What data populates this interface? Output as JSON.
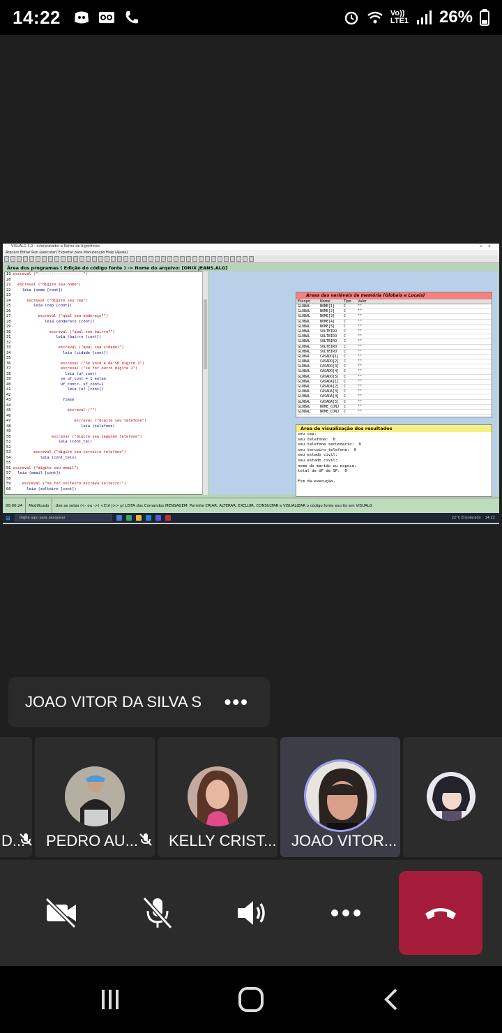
{
  "status_bar": {
    "time": "14:22",
    "network_label": "LTE1",
    "network_top": "Vo))",
    "battery": "26%"
  },
  "shared_screen": {
    "window_title": "VISUALG 3.0 - Interpretador e Editor de Algoritmos",
    "menu": "Arquivo   Editar   Run (executar)   Exportar para   Manutenção   Help (Ajuda)",
    "programs_header": "Área dos programas ( Edição do código fonte ) -> Nome do arquivo: [ONIX JEANS.ALG]",
    "code_lines": [
      {
        "n": "19",
        "t": "escreval (\"--------------------\")"
      },
      {
        "n": "20",
        "t": ""
      },
      {
        "n": "21",
        "t": "  escreval (\"digite seu nome\")"
      },
      {
        "n": "22",
        "t": "    leia (nome [cont])"
      },
      {
        "n": "23",
        "t": ""
      },
      {
        "n": "24",
        "t": "      escreval (\"digite seu cep\")"
      },
      {
        "n": "25",
        "t": "         leia (cep [cont])"
      },
      {
        "n": "26",
        "t": ""
      },
      {
        "n": "27",
        "t": "           escreval (\"qual seu endereço?\")"
      },
      {
        "n": "28",
        "t": "              leia (endereco [cont])"
      },
      {
        "n": "29",
        "t": ""
      },
      {
        "n": "30",
        "t": "                escreval (\"qual seu bairro?\")"
      },
      {
        "n": "31",
        "t": "                   leia (bairro [cont])"
      },
      {
        "n": "32",
        "t": ""
      },
      {
        "n": "33",
        "t": "                    escreval (\"qual sua cidade?\")"
      },
      {
        "n": "34",
        "t": "                      leia (cidade [cont])"
      },
      {
        "n": "35",
        "t": ""
      },
      {
        "n": "36",
        "t": "                     escreval (\"Se você é de SP digite 1\")"
      },
      {
        "n": "37",
        "t": "                     escreval (\"se for outro digite 2\")"
      },
      {
        "n": "38",
        "t": "                       leia (uf_cont)"
      },
      {
        "n": "39",
        "t": "                     se uf_cont = 1 entao"
      },
      {
        "n": "40",
        "t": "                     uf_cont<- uf_cont+1"
      },
      {
        "n": "41",
        "t": "                        leia (uf [cont])"
      },
      {
        "n": "42",
        "t": ""
      },
      {
        "n": "43",
        "t": "                      fimse"
      },
      {
        "n": "44",
        "t": ""
      },
      {
        "n": "45",
        "t": "                        escreval (\"\")"
      },
      {
        "n": "46",
        "t": ""
      },
      {
        "n": "47",
        "t": "                           escreval (\"digite seu telefone\")"
      },
      {
        "n": "48",
        "t": "                              leia (telefone)"
      },
      {
        "n": "49",
        "t": ""
      },
      {
        "n": "50",
        "t": "                 escreval (\"digite seu segundo telefone\")"
      },
      {
        "n": "51",
        "t": "                    leia (cont_tel)"
      },
      {
        "n": "52",
        "t": ""
      },
      {
        "n": "53",
        "t": "         escreval (\"digite seu terceiro telefone\")"
      },
      {
        "n": "54",
        "t": "            leia (cont_tels)"
      },
      {
        "n": "55",
        "t": ""
      },
      {
        "n": "56",
        "t": "escreval (\"digite seu email\")"
      },
      {
        "n": "57",
        "t": "  leia (email [cont])"
      },
      {
        "n": "58",
        "t": ""
      },
      {
        "n": "59",
        "t": "    escreval (\"se for solteiro escreva solteiro:\")"
      },
      {
        "n": "60",
        "t": "      leia (solteiro [cont])"
      }
    ],
    "vars_title": "Áreas das variáveis de memória (Globais e Locais)",
    "vars_headers": [
      "Escopo",
      "Nome",
      "Tipo",
      "Valor"
    ],
    "vars_rows": [
      [
        "GLOBAL",
        "NOME[1]",
        "C",
        "\"\""
      ],
      [
        "GLOBAL",
        "NOME[2]",
        "C",
        "\"\""
      ],
      [
        "GLOBAL",
        "NOME[3]",
        "C",
        "\"\""
      ],
      [
        "GLOBAL",
        "NOME[4]",
        "C",
        "\"\""
      ],
      [
        "GLOBAL",
        "NOME[5]",
        "C",
        "\"\""
      ],
      [
        "GLOBAL",
        "SOLTEIRO",
        "C",
        "\"\""
      ],
      [
        "GLOBAL",
        "SOLTEIRO",
        "C",
        "\"\""
      ],
      [
        "GLOBAL",
        "SOLTEIRO",
        "C",
        "\"\""
      ],
      [
        "GLOBAL",
        "SOLTEIRO",
        "C",
        "\"\""
      ],
      [
        "GLOBAL",
        "SOLTEIRO",
        "C",
        "\"\""
      ],
      [
        "GLOBAL",
        "CASADO[1]",
        "C",
        "\"\""
      ],
      [
        "GLOBAL",
        "CASADO[2]",
        "C",
        "\"\""
      ],
      [
        "GLOBAL",
        "CASADO[3]",
        "C",
        "\"\""
      ],
      [
        "GLOBAL",
        "CASADO[4]",
        "C",
        "\"\""
      ],
      [
        "GLOBAL",
        "CASADO[5]",
        "C",
        "\"\""
      ],
      [
        "GLOBAL",
        "CASADA[1]",
        "C",
        "\"\""
      ],
      [
        "GLOBAL",
        "CASADA[2]",
        "C",
        "\"\""
      ],
      [
        "GLOBAL",
        "CASADA[3]",
        "C",
        "\"\""
      ],
      [
        "GLOBAL",
        "CASADA[4]",
        "C",
        "\"\""
      ],
      [
        "GLOBAL",
        "CASADA[5]",
        "C",
        "\"\""
      ],
      [
        "GLOBAL",
        "NOME_CONJ",
        "C",
        "\"\""
      ],
      [
        "GLOBAL",
        "NOME_CONJ",
        "C",
        "\"\""
      ]
    ],
    "results_title": "Área de visualização dos resultados",
    "results_lines": [
      "seu cep:",
      "seu telefone:  0",
      "seu telefone secundario:  0",
      "seu terceiro telefone:  0",
      "seu estado civil:",
      "seu estado civil:",
      "nome do marido ou esposa:",
      "total de UF de SP:  0",
      "",
      "Fim da execução."
    ],
    "status_cells": [
      "00:00:24",
      "Modificado",
      "Use as setas (<- ou ->) <Ctrl J>> p/ LISTA dos Comandos  MENSAGEM: Permite CRIAR, ALTERAR, EXCLUIR, CONSULTAR e VISUALIZAR o código fonte escrito em VISUALG"
    ],
    "taskbar_search": "Digite aqui para pesquisar",
    "taskbar_weather": "22°C  Ensolarado",
    "taskbar_time": "14:22"
  },
  "name_chip": {
    "name": "JOAO VITOR DA SILVA S",
    "more": "•••"
  },
  "participants": [
    {
      "label": "D..."
    },
    {
      "label": "PEDRO AU..."
    },
    {
      "label": "KELLY CRIST..."
    },
    {
      "label": "JOAO VITOR..."
    },
    {
      "label": ""
    }
  ],
  "colors": {
    "hangup": "#a51c3a",
    "active_ring": "#9b9bf0"
  }
}
